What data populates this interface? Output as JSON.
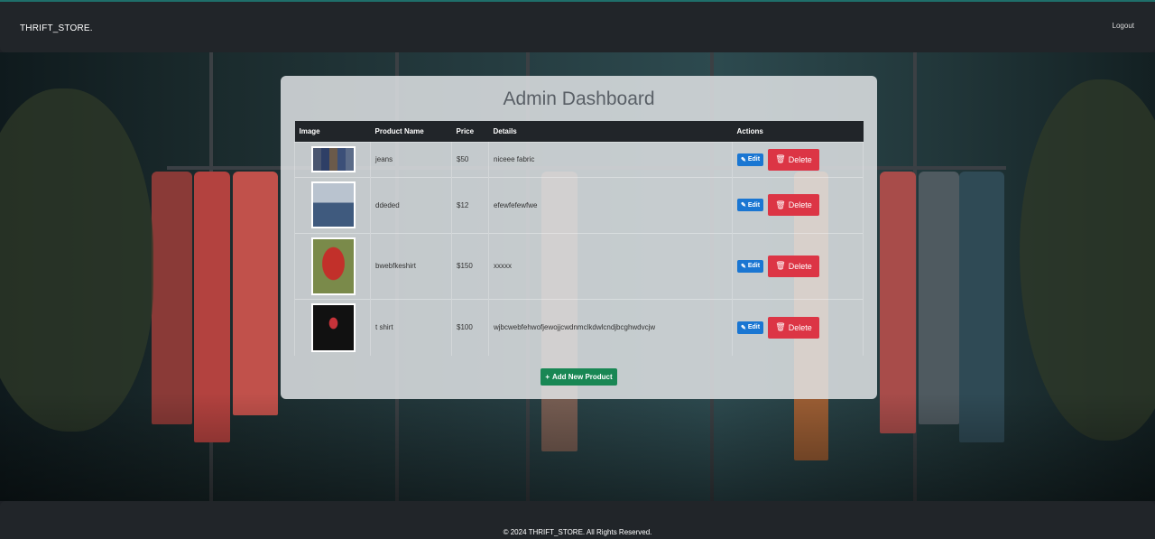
{
  "navbar": {
    "brand": "THRIFT_STORE.",
    "logout_label": "Logout"
  },
  "dashboard": {
    "title": "Admin Dashboard",
    "columns": [
      "Image",
      "Product Name",
      "Price",
      "Details",
      "Actions"
    ],
    "products": [
      {
        "image": "jeans-thumbnail",
        "name": "jeans",
        "price": "$50",
        "details": "niceee fabric"
      },
      {
        "image": "denim-outfit-thumbnail",
        "name": "ddeded",
        "price": "$12",
        "details": "efewfefewfwe"
      },
      {
        "image": "red-shirt-thumbnail",
        "name": "bwebfkeshirt",
        "price": "$150",
        "details": "xxxxx"
      },
      {
        "image": "black-tshirt-thumbnail",
        "name": "t shirt",
        "price": "$100",
        "details": "wjbcwebfehwofjewojjcwdnmclkdwlcndjbcghwdvcjw"
      }
    ],
    "edit_label": "Edit",
    "delete_label": "Delete",
    "add_label": "Add New Product"
  },
  "footer": {
    "text": "© 2024 THRIFT_STORE. All Rights Reserved."
  },
  "icons": {
    "edit": "edit-icon",
    "delete": "trash-icon",
    "add": "plus-icon"
  },
  "colors": {
    "navbar": "#212529",
    "edit": "#1a76d2",
    "delete": "#dc3545",
    "add": "#198754"
  }
}
